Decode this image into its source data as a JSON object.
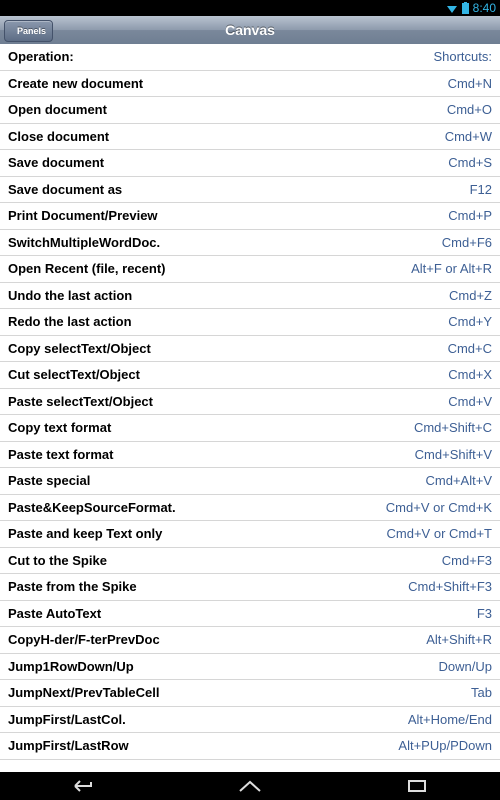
{
  "status": {
    "time": "8:40"
  },
  "navbar": {
    "title": "Canvas",
    "back_label": "Panels"
  },
  "header": {
    "operation": "Operation:",
    "shortcut": "Shortcuts:"
  },
  "rows": [
    {
      "op": "Create new document",
      "sc": "Cmd+N"
    },
    {
      "op": "Open document",
      "sc": "Cmd+O"
    },
    {
      "op": "Close document",
      "sc": "Cmd+W"
    },
    {
      "op": "Save document",
      "sc": "Cmd+S"
    },
    {
      "op": "Save document as",
      "sc": "F12"
    },
    {
      "op": "Print Document/Preview",
      "sc": "Cmd+P"
    },
    {
      "op": "SwitchMultipleWordDoc.",
      "sc": "Cmd+F6"
    },
    {
      "op": "Open Recent (file, recent)",
      "sc": "Alt+F or Alt+R"
    },
    {
      "op": "Undo the last action",
      "sc": "Cmd+Z"
    },
    {
      "op": "Redo the last action",
      "sc": "Cmd+Y"
    },
    {
      "op": "Copy selectText/Object",
      "sc": "Cmd+C"
    },
    {
      "op": "Cut selectText/Object",
      "sc": "Cmd+X"
    },
    {
      "op": "Paste selectText/Object",
      "sc": "Cmd+V"
    },
    {
      "op": "Copy text format",
      "sc": "Cmd+Shift+C"
    },
    {
      "op": "Paste text format",
      "sc": "Cmd+Shift+V"
    },
    {
      "op": "Paste special",
      "sc": "Cmd+Alt+V"
    },
    {
      "op": "Paste&KeepSourceFormat.",
      "sc": "Cmd+V or Cmd+K"
    },
    {
      "op": "Paste and keep Text only",
      "sc": "Cmd+V or Cmd+T"
    },
    {
      "op": "Cut to the Spike",
      "sc": "Cmd+F3"
    },
    {
      "op": "Paste from the Spike",
      "sc": "Cmd+Shift+F3"
    },
    {
      "op": "Paste AutoText",
      "sc": "F3"
    },
    {
      "op": "CopyH-der/F-terPrevDoc",
      "sc": "Alt+Shift+R"
    },
    {
      "op": "Jump1RowDown/Up",
      "sc": "Down/Up"
    },
    {
      "op": "JumpNext/PrevTableCell",
      "sc": "Tab"
    },
    {
      "op": "JumpFirst/LastCol.",
      "sc": "Alt+Home/End"
    },
    {
      "op": "JumpFirst/LastRow",
      "sc": "Alt+PUp/PDown"
    }
  ],
  "icons": {
    "back": "back-icon",
    "home": "home-icon",
    "recents": "recents-icon",
    "wifi": "wifi-icon",
    "battery": "battery-icon"
  }
}
